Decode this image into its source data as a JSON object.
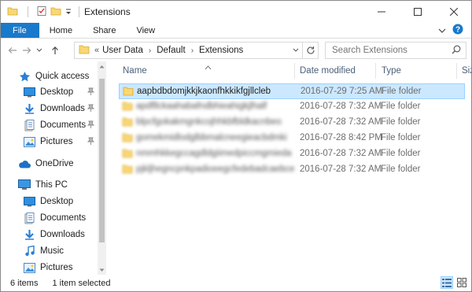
{
  "window": {
    "title": "Extensions"
  },
  "ribbon": {
    "tabs": [
      "File",
      "Home",
      "Share",
      "View"
    ]
  },
  "address": {
    "overflow": "«",
    "crumbs": [
      "User Data",
      "Default",
      "Extensions"
    ]
  },
  "search": {
    "placeholder": "Search Extensions"
  },
  "nav": {
    "quick_access": "Quick access",
    "desktop": "Desktop",
    "downloads": "Downloads",
    "documents": "Documents",
    "pictures": "Pictures",
    "onedrive": "OneDrive",
    "this_pc": "This PC",
    "pc_desktop": "Desktop",
    "pc_documents": "Documents",
    "pc_downloads": "Downloads",
    "pc_music": "Music",
    "pc_pictures": "Pictures"
  },
  "columns": {
    "name": "Name",
    "date_modified": "Date modified",
    "type": "Type",
    "size": "Size"
  },
  "files": [
    {
      "name": "aapbdbdomjkkjkaonfhkkikfgjllcleb",
      "date": "2016-07-29 7:25 AM",
      "type": "File folder"
    },
    {
      "name": "apdfllckaahabafndbhieahigkjlhalf",
      "date": "2016-07-28 7:32 AM",
      "type": "File folder"
    },
    {
      "name": "blpcfgokakmgnkcojhhkbfbldkacnbeo",
      "date": "2016-07-28 7:32 AM",
      "type": "File folder"
    },
    {
      "name": "gomekmidlodglbbmalcneegieacbdmki",
      "date": "2016-07-28 8:42 PM",
      "type": "File folder"
    },
    {
      "name": "nmmhkkegccagdldgiimedpiccmgmieda",
      "date": "2016-07-28 7:32 AM",
      "type": "File folder"
    },
    {
      "name": "pjkljhegncpnkpadioeegcfedebadcaebce",
      "date": "2016-07-28 7:32 AM",
      "type": "File folder"
    }
  ],
  "status": {
    "items": "6 items",
    "selected": "1 item selected"
  },
  "colors": {
    "file_tab": "#1979ca",
    "selection": "#cce8ff",
    "folder": "#f8d775"
  }
}
